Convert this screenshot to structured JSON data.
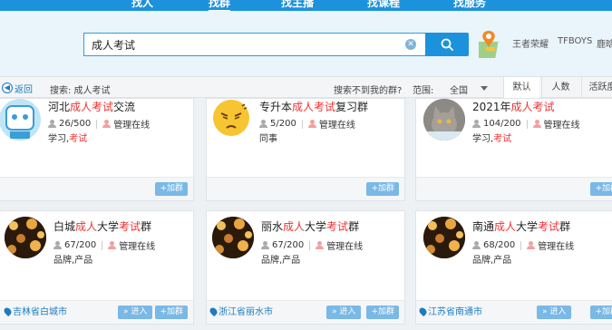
{
  "nav": {
    "tabs": [
      {
        "label": "找人"
      },
      {
        "label": "找群"
      },
      {
        "label": "找主播"
      },
      {
        "label": "找课程"
      },
      {
        "label": "找服务"
      }
    ]
  },
  "search": {
    "value": "成人考试",
    "hot_words": [
      "王者荣耀",
      "TFBOYS",
      "鹿晗"
    ]
  },
  "filter_bar": {
    "back_label": "返回",
    "search_label": "搜索: 成人考试",
    "not_found_link": "搜索不到我的群?",
    "range_label": "范围:",
    "range_value": "全国",
    "sort_tabs": [
      "默认",
      "人数",
      "活跃度"
    ]
  },
  "cards": [
    {
      "title_pre": "河北",
      "title_hl": "成人考试",
      "title_post": "交流",
      "members": "26/500",
      "status": "管理在线",
      "tag_pre": "学习,",
      "tag_hl": "考试",
      "join_label": "+加群"
    },
    {
      "title_pre": "专升本",
      "title_hl": "成人考试",
      "title_post": "复习群",
      "members": "5/200",
      "status": "管理在线",
      "tag_pre": "同事",
      "tag_hl": "",
      "join_label": "+加群"
    },
    {
      "title_pre": "2021年",
      "title_hl": "成人考试",
      "title_post": "",
      "members": "104/200",
      "status": "管理在线",
      "tag_pre": "学习,",
      "tag_hl": "考试",
      "join_label": "+加群"
    },
    {
      "title_a": "白城",
      "title_b": "成人",
      "title_c": "大学",
      "title_d": "考试",
      "title_e": "群",
      "members": "67/200",
      "status": "管理在线",
      "tags": "品牌,产品",
      "location": "吉林省白城市",
      "enter_label": "» 进入",
      "join_label": "+加群"
    },
    {
      "title_a": "丽水",
      "title_b": "成人",
      "title_c": "大学",
      "title_d": "考试",
      "title_e": "群",
      "members": "67/200",
      "status": "管理在线",
      "tags": "品牌,产品",
      "location": "浙江省丽水市",
      "enter_label": "» 进入",
      "join_label": "+加群"
    },
    {
      "title_a": "南通",
      "title_b": "成人",
      "title_c": "大学",
      "title_d": "考试",
      "title_e": "群",
      "members": "68/200",
      "status": "管理在线",
      "tags": "品牌,产品",
      "location": "江苏省南通市",
      "enter_label": "» 进入",
      "join_label": "+加群"
    }
  ]
}
